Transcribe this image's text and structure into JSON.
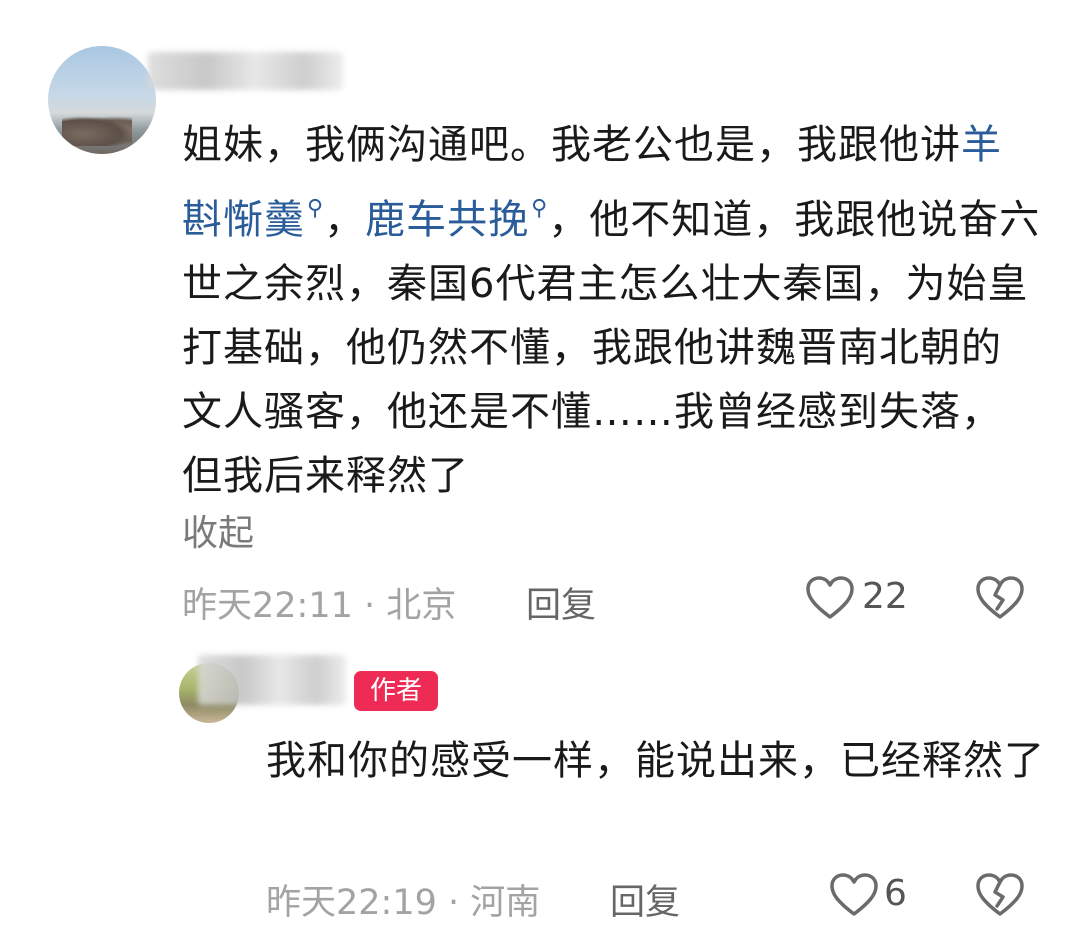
{
  "comment": {
    "text_part1": "姐妹，我俩沟通吧。我老公也是，我跟他讲",
    "link1": "羊斟惭羹",
    "sep1": "，",
    "link2": "鹿车共挽",
    "text_part2": "，他不知道，我跟他说奋六世之余烈，秦国6代君主怎么壮大秦国，为始皇打基础，他仍然不懂，我跟他讲魏晋南北朝的文人骚客，他还是不懂……我曾经感到失落，但我后来释然了",
    "collapse_label": "收起",
    "timestamp": "昨天22:11",
    "dot": "·",
    "location": "北京",
    "reply_label": "回复",
    "likes": "22",
    "icons": [
      "heart-outline-icon",
      "broken-heart-icon"
    ]
  },
  "reply": {
    "badge": "作者",
    "text": "我和你的感受一样，能说出来，已经释然了",
    "timestamp": "昨天22:19",
    "dot": "·",
    "location": "河南",
    "reply_label": "回复",
    "likes": "6",
    "icons": [
      "heart-outline-icon",
      "broken-heart-icon"
    ]
  },
  "colors": {
    "link": "#2a5c9a",
    "badge_bg": "#ee2b55",
    "meta_gray": "#a3a3a3"
  }
}
